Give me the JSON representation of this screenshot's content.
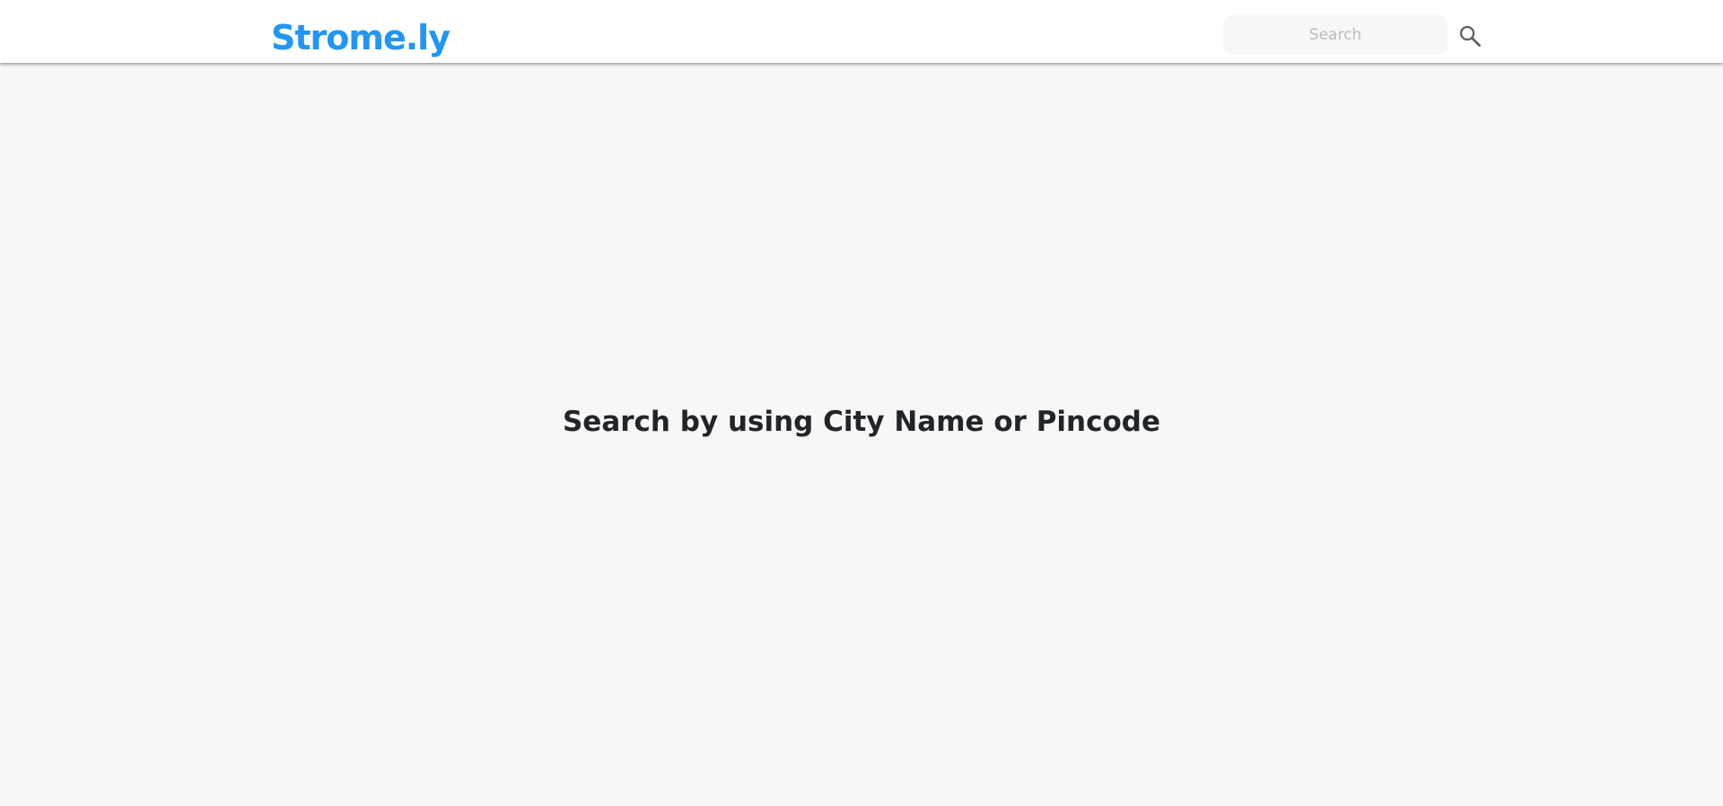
{
  "header": {
    "brand": "Strome.ly",
    "brand_color": "#2196f3",
    "search": {
      "placeholder": "Search",
      "value": "",
      "button_icon": "search-icon"
    }
  },
  "main": {
    "prompt": "Search by using City Name or Pincode"
  },
  "colors": {
    "page_background": "#f7f7f7",
    "navbar_background": "#ffffff",
    "text": "#212529"
  }
}
